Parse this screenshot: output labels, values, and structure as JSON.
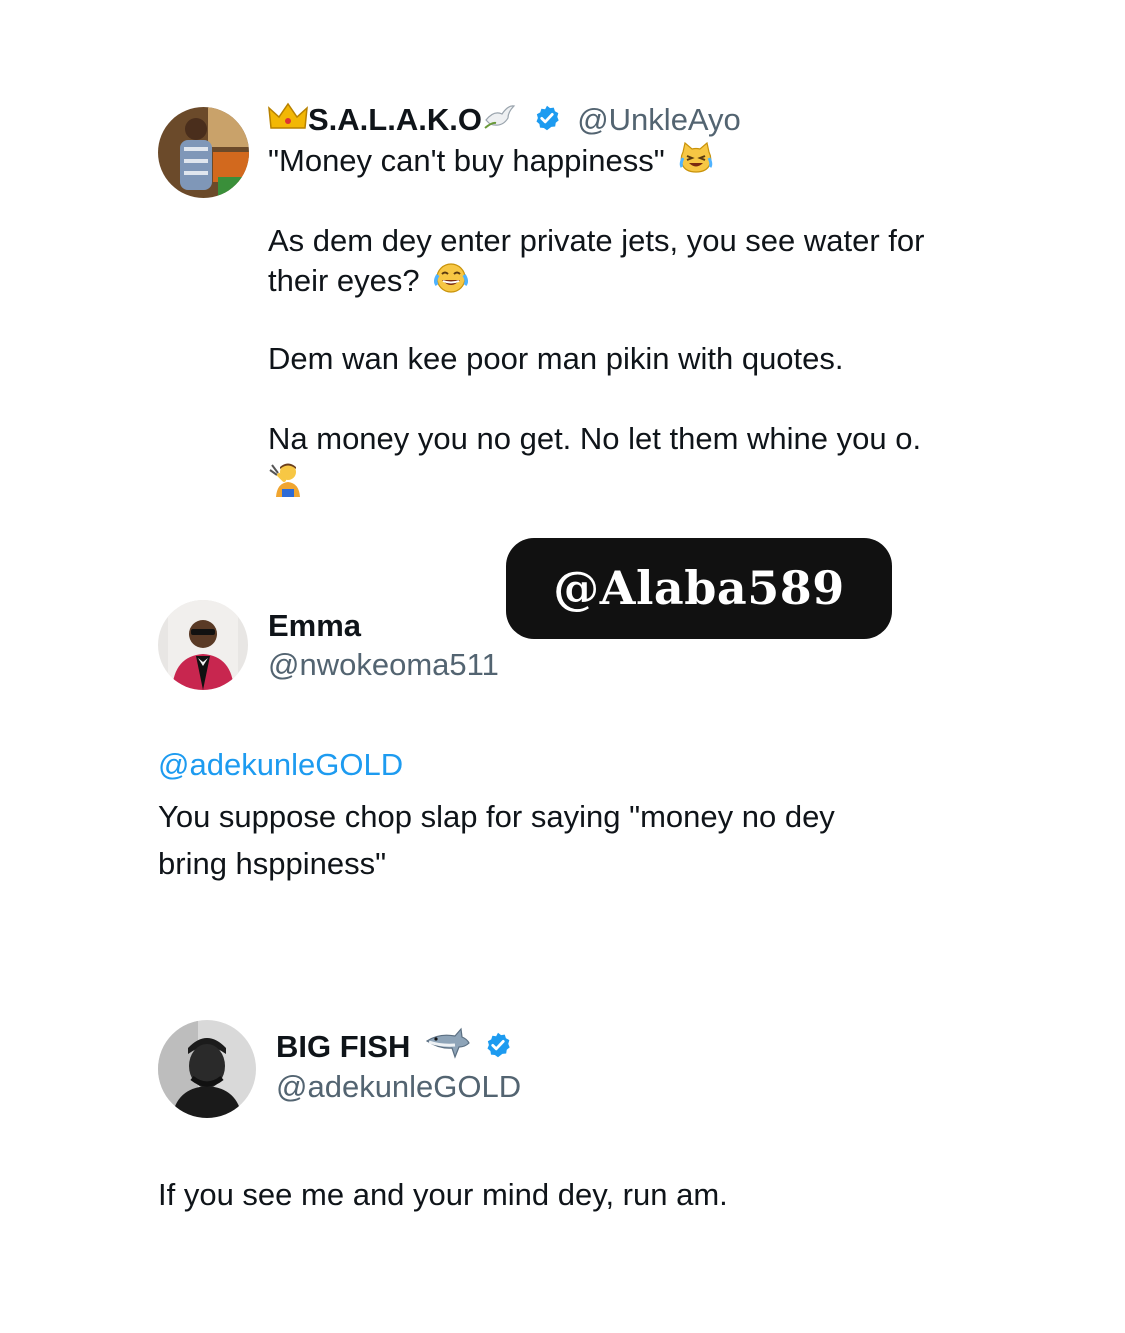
{
  "tweet1": {
    "display_name": "S.A.L.A.K.O",
    "handle": "@UnkleAyo",
    "verified": true,
    "name_icons": [
      "crown-icon",
      "dove-icon"
    ],
    "line1": "\"Money can't buy happiness\"",
    "para2_line1": "As dem dey enter private jets, you see water for",
    "para2_line2": "their eyes?",
    "para3": "Dem wan kee poor man pikin with quotes.",
    "para4": "Na money you no get. No let them whine you o.",
    "emojis": [
      "crying-laughing-cat-icon",
      "tears-of-joy-icon",
      "person-fanning-icon"
    ]
  },
  "watermark": {
    "text": "@Alaba589"
  },
  "tweet2": {
    "display_name": "Emma",
    "handle": "@nwokeoma511",
    "mention": "@adekunleGOLD",
    "line1": "You suppose chop slap for saying \"money no dey",
    "line2": "bring hsppiness\""
  },
  "tweet3": {
    "display_name": "BIG FISH",
    "handle": "@adekunleGOLD",
    "verified": true,
    "name_icons": [
      "shark-icon"
    ],
    "body": "If you see me and your mind dey, run am."
  },
  "colors": {
    "link_blue": "#1d9bf0",
    "verified_blue": "#1d9bf0",
    "secondary_text": "#536471",
    "primary_text": "#0f1419",
    "watermark_bg": "#111111"
  }
}
